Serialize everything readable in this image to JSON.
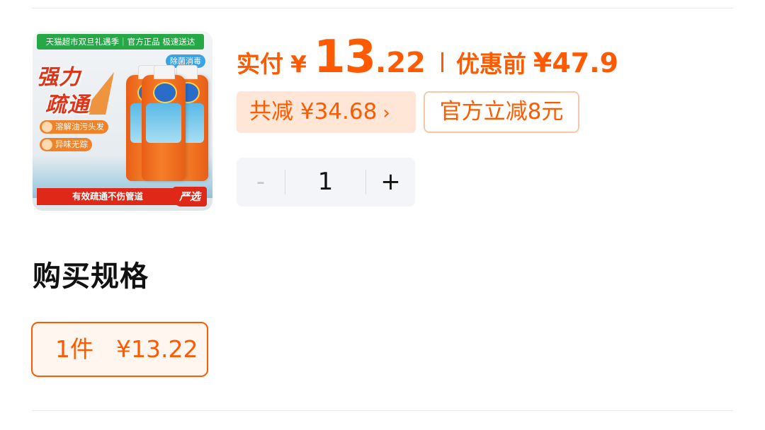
{
  "product": {
    "image": {
      "alt": "威猛先生 强力疏通剂",
      "top_banner": "天猫超市双旦礼遇季｜官方正品 极速送达",
      "corner_tag": "除菌消毒",
      "headline_line1": "强力",
      "headline_line2": "疏通",
      "feature_1": "溶解油污头发",
      "feature_2": "异味无踪",
      "bottom_bar": "有效疏通不伤管道",
      "select_badge": "严选"
    }
  },
  "price": {
    "pay_label": "实付",
    "currency": "¥",
    "integer": "13",
    "decimal": ".22",
    "original_label": "优惠前",
    "original_price": "¥47.9"
  },
  "discount": {
    "total_label": "共减 ¥34.68",
    "chevron": "›",
    "coupon_label": "官方立减8元"
  },
  "quantity": {
    "minus": "-",
    "value": "1",
    "plus": "+"
  },
  "spec": {
    "title": "购买规格",
    "options": [
      {
        "qty_label": "1件",
        "price_label": "¥13.22",
        "selected": true
      }
    ]
  },
  "colors": {
    "accent": "#ff5a00",
    "discount_bg": "#ffe6d6",
    "stepper_bg": "#f3f5f8"
  }
}
